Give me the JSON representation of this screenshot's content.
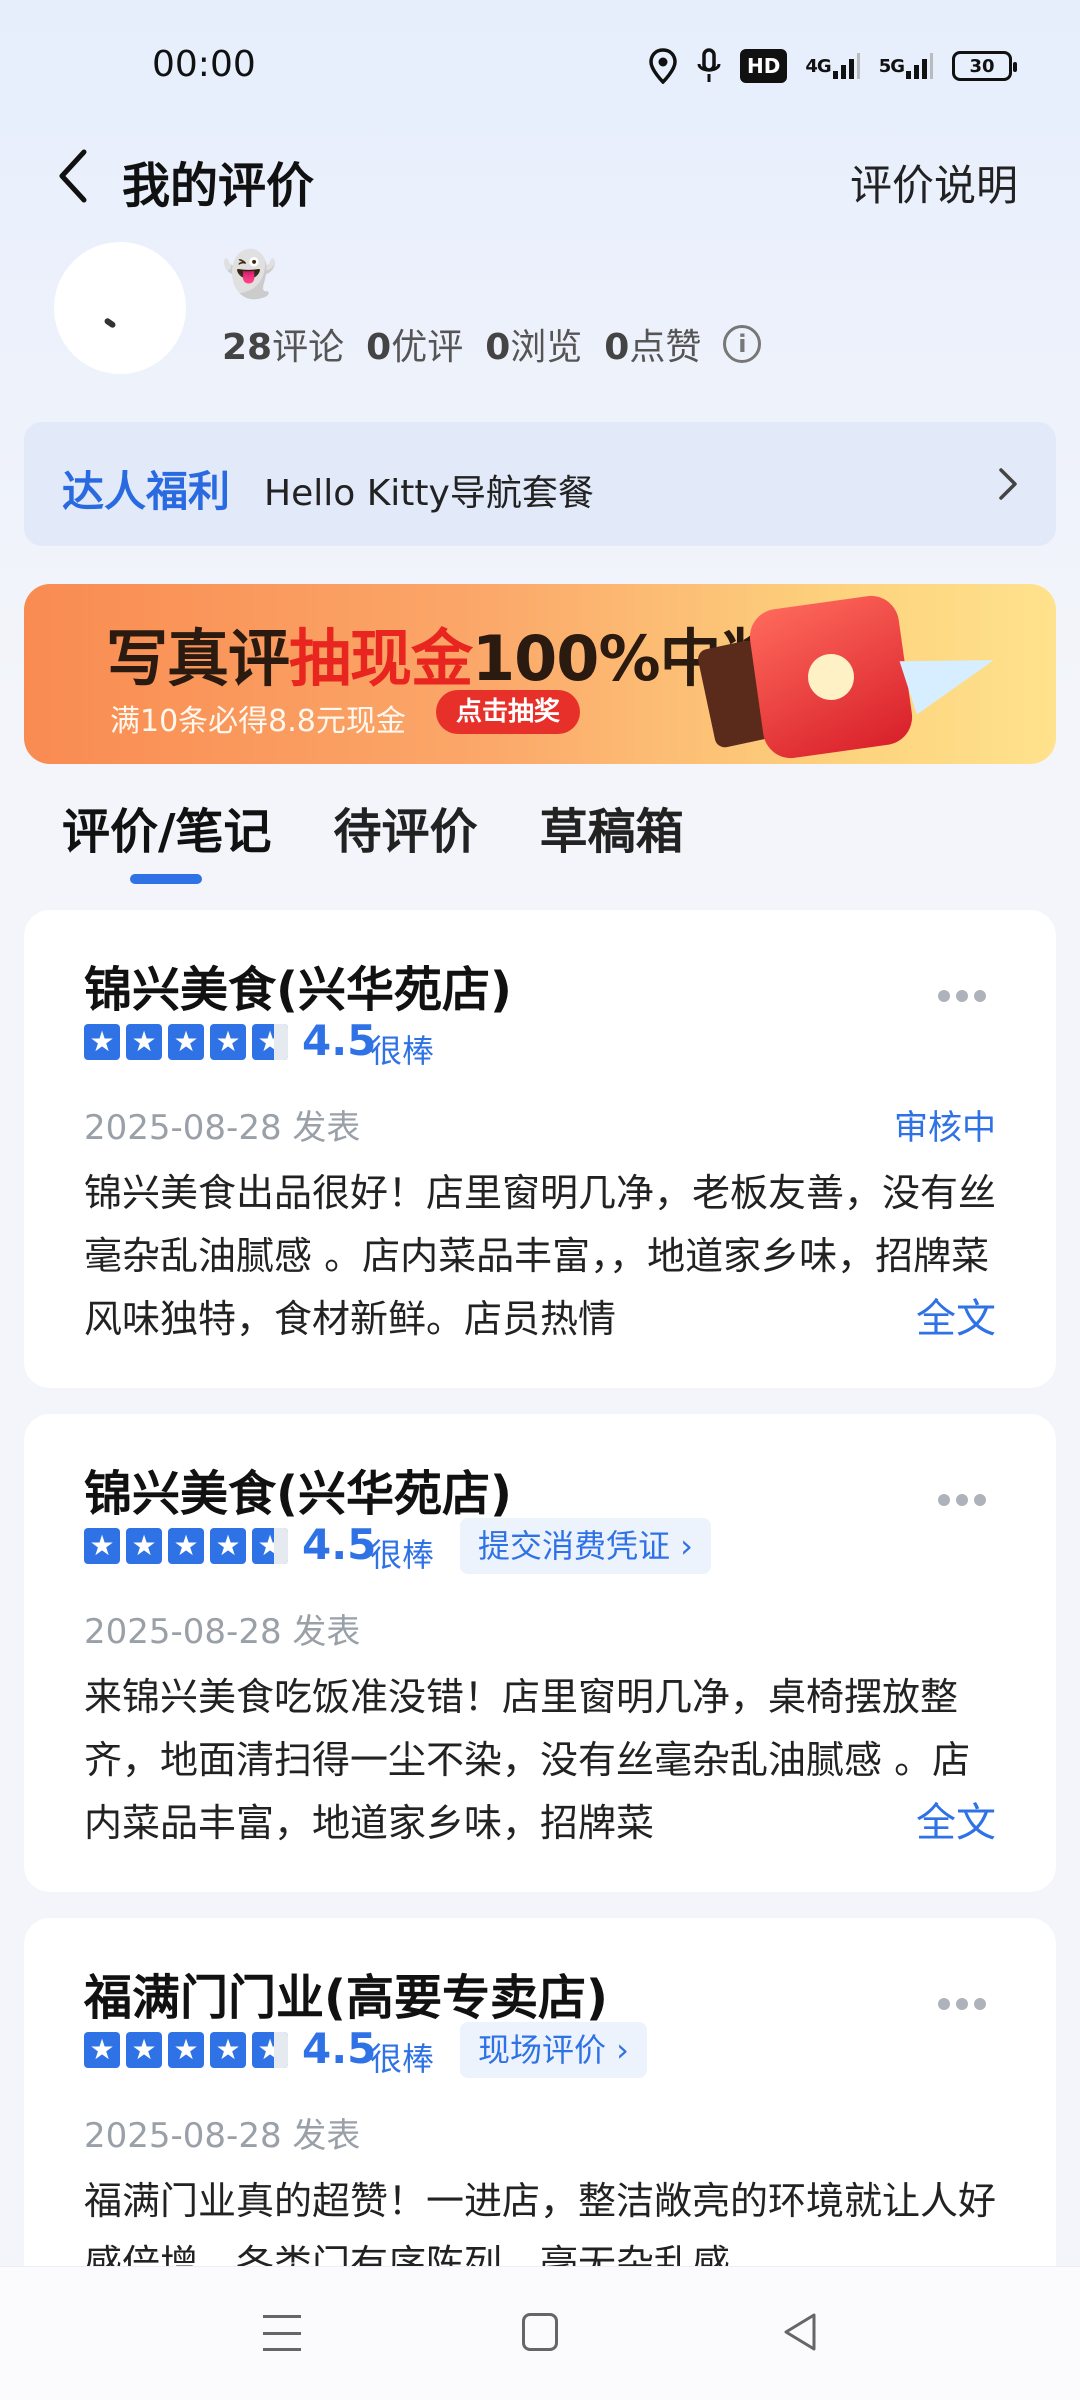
{
  "status_bar": {
    "time": "00:00",
    "icons": [
      "location-icon",
      "microphone-icon",
      "hd-icon",
      "4g-signal-icon",
      "5g-signal-icon",
      "battery-icon"
    ],
    "hd": "HD",
    "net1": "4G",
    "net2": "5G",
    "battery": "30"
  },
  "header": {
    "title": "我的评价",
    "help": "评价说明"
  },
  "profile": {
    "emoji": "👻",
    "comments_count": "28",
    "comments_label": "评论",
    "good_count": "0",
    "good_label": "优评",
    "views_count": "0",
    "views_label": "浏览",
    "likes_count": "0",
    "likes_label": "点赞"
  },
  "welfare": {
    "tag": "达人福利",
    "text": "Hello Kitty导航套餐"
  },
  "banner": {
    "headline_a": "写真评",
    "headline_b": "抽现金",
    "headline_c": "100%中奖",
    "sub": "满10条必得8.8元现金",
    "cta": "点击抽奖"
  },
  "tabs": [
    {
      "label": "评价/笔记",
      "active": true
    },
    {
      "label": "待评价",
      "active": false
    },
    {
      "label": "草稿箱",
      "active": false
    }
  ],
  "reviews": [
    {
      "shop": "锦兴美食(兴华苑店)",
      "rating": 4.5,
      "score": "4.5",
      "score_label": "很棒",
      "chip": "",
      "date": "2025-08-28 发表",
      "status": "审核中",
      "body": "锦兴美食出品很好！店里窗明几净，老板友善，没有丝毫杂乱油腻感 。店内菜品丰富，，地道家乡味，招牌菜风味独特，食材新鲜。店员热情",
      "fulltext": "全文"
    },
    {
      "shop": "锦兴美食(兴华苑店)",
      "rating": 4.5,
      "score": "4.5",
      "score_label": "很棒",
      "chip": "提交消费凭证 ›",
      "date": "2025-08-28 发表",
      "status": "",
      "body": "来锦兴美食吃饭准没错！店里窗明几净，桌椅摆放整齐，地面清扫得一尘不染，没有丝毫杂乱油腻感 。店内菜品丰富，地道家乡味，招牌菜",
      "fulltext": "全文"
    },
    {
      "shop": "福满门门业(高要专卖店)",
      "rating": 4.5,
      "score": "4.5",
      "score_label": "很棒",
      "chip": "现场评价 ›",
      "date": "2025-08-28 发表",
      "status": "",
      "body": "福满门业真的超赞！一进店，整洁敞亮的环境就让人好感倍增，各类门有序陈列，毫无杂乱感",
      "fulltext": ""
    }
  ],
  "nav": [
    "menu-icon",
    "home-icon",
    "back-icon"
  ]
}
